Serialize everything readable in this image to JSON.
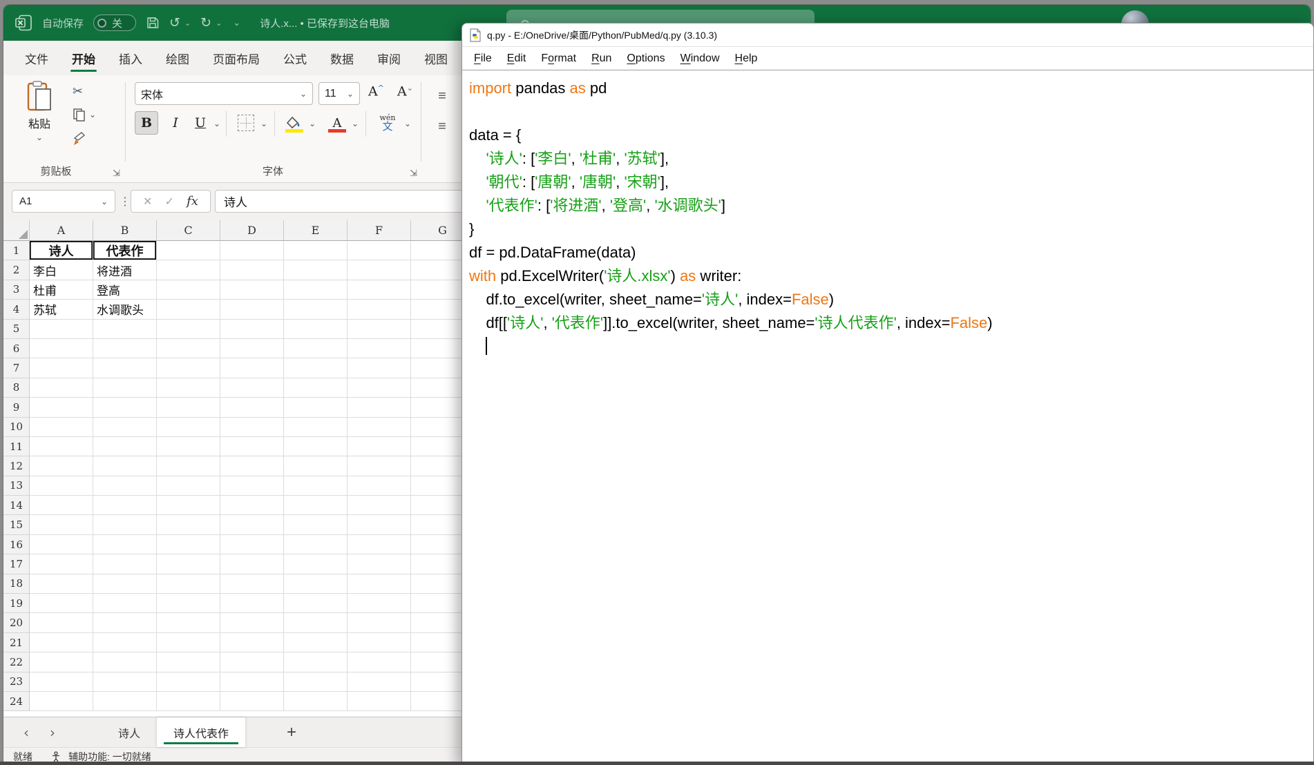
{
  "excel": {
    "titlebar": {
      "autosave_label": "自动保存",
      "autosave_state": "关",
      "doc_title": "诗人.x... • 已保存到这台电脑"
    },
    "menu_tabs": [
      "文件",
      "开始",
      "插入",
      "绘图",
      "页面布局",
      "公式",
      "数据",
      "审阅",
      "视图"
    ],
    "active_tab": "开始",
    "ribbon": {
      "paste_label": "粘贴",
      "clipboard_group": "剪贴板",
      "font_group": "字体",
      "font_name": "宋体",
      "font_size": "11",
      "phonetic_top": "wén",
      "phonetic_bottom": "文"
    },
    "formula_bar": {
      "name_box": "A1",
      "formula": "诗人"
    },
    "grid": {
      "columns": [
        "A",
        "B",
        "C",
        "D",
        "E",
        "F",
        "G"
      ],
      "rows": 24,
      "header_row": 1,
      "cells": {
        "A1": "诗人",
        "B1": "代表作",
        "A2": "李白",
        "B2": "将进酒",
        "A3": "杜甫",
        "B3": "登高",
        "A4": "苏轼",
        "B4": "水调歌头"
      }
    },
    "sheet_tabs": [
      {
        "label": "诗人",
        "active": false
      },
      {
        "label": "诗人代表作",
        "active": true
      }
    ],
    "status": {
      "ready": "就绪",
      "accessibility": "辅助功能: 一切就绪"
    }
  },
  "idle": {
    "title": "q.py - E:/OneDrive/桌面/Python/PubMed/q.py (3.10.3)",
    "menus": [
      {
        "label": "File",
        "u": 0
      },
      {
        "label": "Edit",
        "u": 0
      },
      {
        "label": "Format",
        "u": 1
      },
      {
        "label": "Run",
        "u": 0
      },
      {
        "label": "Options",
        "u": 0
      },
      {
        "label": "Window",
        "u": 0
      },
      {
        "label": "Help",
        "u": 0
      }
    ],
    "colors": {
      "keyword": "#ee7712",
      "string": "#16a016",
      "plain": "#000000"
    },
    "code": [
      {
        "segs": [
          [
            "k",
            "import"
          ],
          [
            "p",
            " pandas "
          ],
          [
            "k",
            "as"
          ],
          [
            "p",
            " pd"
          ]
        ]
      },
      {
        "segs": []
      },
      {
        "segs": [
          [
            "p",
            "data = {"
          ]
        ]
      },
      {
        "segs": [
          [
            "p",
            "    "
          ],
          [
            "s",
            "'诗人'"
          ],
          [
            "p",
            ": ["
          ],
          [
            "s",
            "'李白'"
          ],
          [
            "p",
            ", "
          ],
          [
            "s",
            "'杜甫'"
          ],
          [
            "p",
            ", "
          ],
          [
            "s",
            "'苏轼'"
          ],
          [
            "p",
            "],"
          ]
        ]
      },
      {
        "segs": [
          [
            "p",
            "    "
          ],
          [
            "s",
            "'朝代'"
          ],
          [
            "p",
            ": ["
          ],
          [
            "s",
            "'唐朝'"
          ],
          [
            "p",
            ", "
          ],
          [
            "s",
            "'唐朝'"
          ],
          [
            "p",
            ", "
          ],
          [
            "s",
            "'宋朝'"
          ],
          [
            "p",
            "],"
          ]
        ]
      },
      {
        "segs": [
          [
            "p",
            "    "
          ],
          [
            "s",
            "'代表作'"
          ],
          [
            "p",
            ": ["
          ],
          [
            "s",
            "'将进酒'"
          ],
          [
            "p",
            ", "
          ],
          [
            "s",
            "'登高'"
          ],
          [
            "p",
            ", "
          ],
          [
            "s",
            "'水调歌头'"
          ],
          [
            "p",
            "]"
          ]
        ]
      },
      {
        "segs": [
          [
            "p",
            "}"
          ]
        ]
      },
      {
        "segs": [
          [
            "p",
            "df = pd.DataFrame(data)"
          ]
        ]
      },
      {
        "segs": [
          [
            "k",
            "with"
          ],
          [
            "p",
            " pd.ExcelWriter("
          ],
          [
            "s",
            "'诗人.xlsx'"
          ],
          [
            "p",
            ") "
          ],
          [
            "k",
            "as"
          ],
          [
            "p",
            " writer:"
          ]
        ]
      },
      {
        "segs": [
          [
            "p",
            "    df.to_excel(writer, sheet_name="
          ],
          [
            "s",
            "'诗人'"
          ],
          [
            "p",
            ", index="
          ],
          [
            "k",
            "False"
          ],
          [
            "p",
            ")"
          ]
        ]
      },
      {
        "segs": [
          [
            "p",
            "    df[["
          ],
          [
            "s",
            "'诗人'"
          ],
          [
            "p",
            ", "
          ],
          [
            "s",
            "'代表作'"
          ],
          [
            "p",
            "]].to_excel(writer, sheet_name="
          ],
          [
            "s",
            "'诗人代表作'"
          ],
          [
            "p",
            ", index="
          ],
          [
            "k",
            "False"
          ],
          [
            "p",
            ")"
          ]
        ]
      },
      {
        "segs": [
          [
            "p",
            "    "
          ]
        ],
        "caret": true
      }
    ]
  },
  "icons": {
    "chevron_down": "⌄",
    "undo": "↺",
    "redo": "↻",
    "cut": "✂",
    "dialog_launcher": "⇲",
    "more_vertical": "⋮",
    "cancel": "✕",
    "enter": "✓",
    "function": "fx",
    "bold": "B",
    "italic": "I",
    "underline": "U",
    "letter_a": "A",
    "grow_mark": "^",
    "shrink_mark": "⌄",
    "prev_sheet": "‹",
    "next_sheet": "›",
    "add_sheet": "+",
    "align_lines": "≡"
  }
}
